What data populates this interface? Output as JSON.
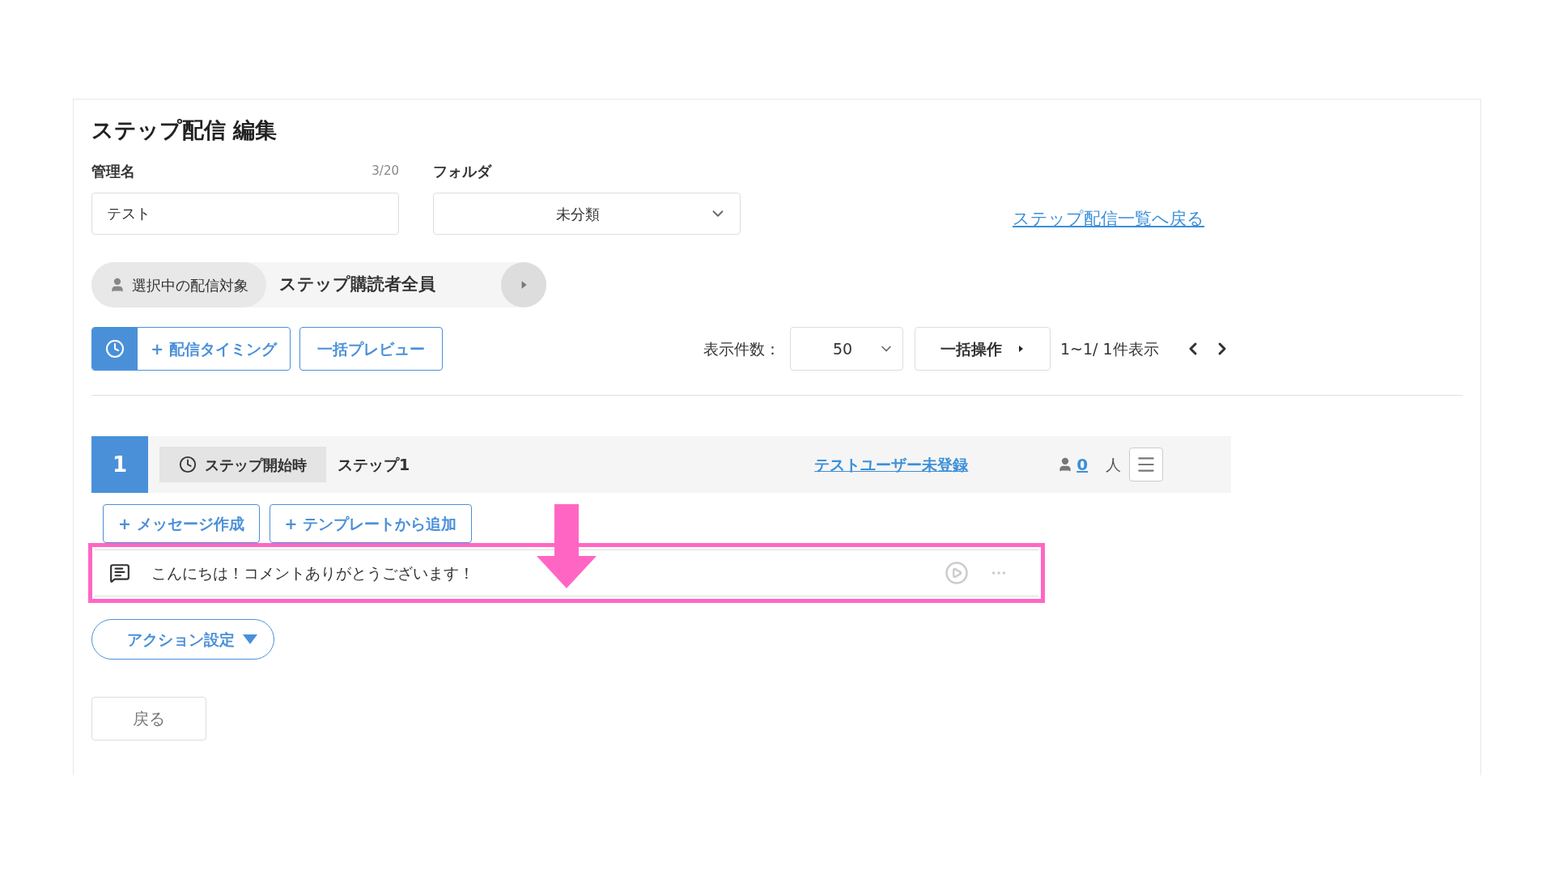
{
  "title": "ステップ配信 編集",
  "name_field": {
    "label": "管理名",
    "counter": "3/20",
    "value": "テスト"
  },
  "folder_field": {
    "label": "フォルダ",
    "value": "未分類"
  },
  "back_to_list_link": "ステップ配信一覧へ戻る",
  "target": {
    "label": "選択中の配信対象",
    "value": "ステップ購読者全員"
  },
  "toolbar": {
    "timing_button": "+ 配信タイミング",
    "preview_button": "一括プレビュー",
    "per_page_label": "表示件数：",
    "per_page_value": "50",
    "bulk_button": "一括操作",
    "paging_text": "1~1/ 1件表示"
  },
  "steps": [
    {
      "number": "1",
      "timing": "ステップ開始時",
      "name": "ステップ1",
      "test_user_link": "テストユーザー未登録",
      "count": "0",
      "count_unit": "人",
      "add_buttons": [
        "+ メッセージ作成",
        "+ テンプレートから追加"
      ],
      "messages": [
        {
          "text": "こんにちは！コメントありがとうございます！",
          "highlighted": true
        }
      ],
      "action_button": "アクション設定"
    }
  ],
  "footer_button": "戻る"
}
